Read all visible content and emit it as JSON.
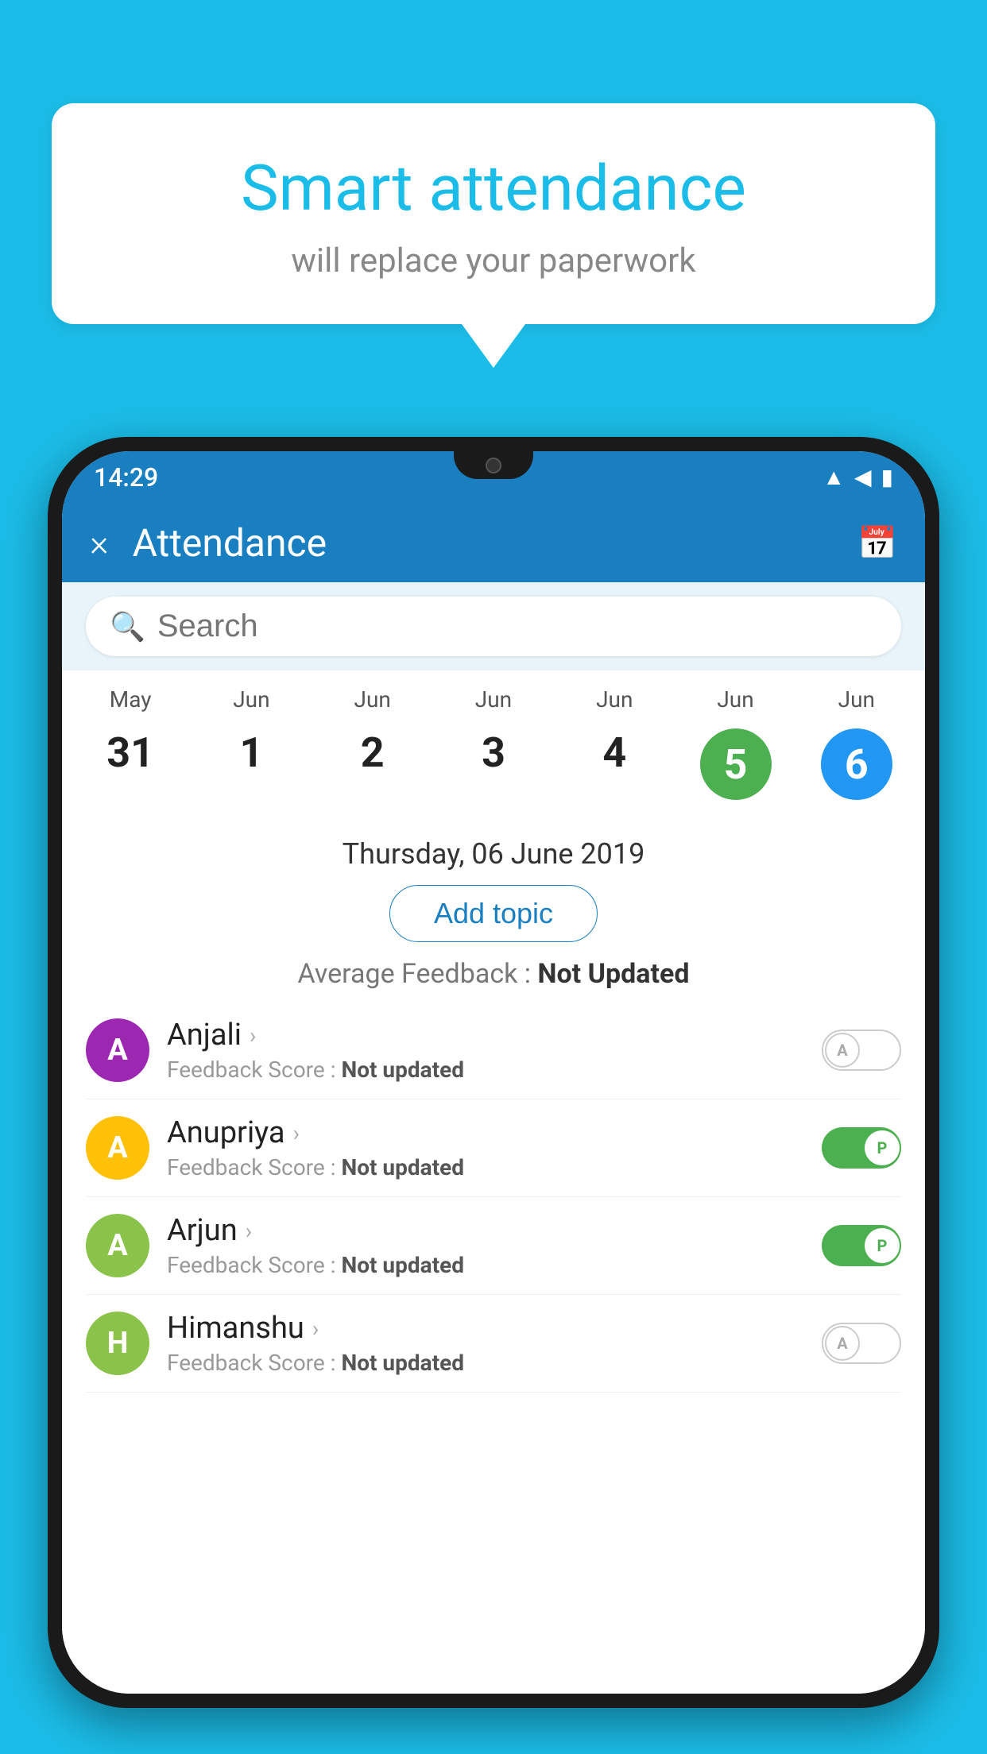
{
  "background_color": "#1BBDE8",
  "speech_bubble": {
    "title": "Smart attendance",
    "subtitle": "will replace your paperwork"
  },
  "status_bar": {
    "time": "14:29",
    "wifi_icon": "wifi",
    "signal_icon": "signal",
    "battery_icon": "battery"
  },
  "app_bar": {
    "close_label": "×",
    "title": "Attendance",
    "calendar_icon": "calendar"
  },
  "search": {
    "placeholder": "Search"
  },
  "calendar": {
    "months": [
      "May",
      "Jun",
      "Jun",
      "Jun",
      "Jun",
      "Jun",
      "Jun"
    ],
    "days": [
      "31",
      "1",
      "2",
      "3",
      "4",
      "5",
      "6"
    ],
    "selected_index": 6,
    "today_index": 5
  },
  "selected_date_label": "Thursday, 06 June 2019",
  "add_topic_label": "Add topic",
  "avg_feedback": {
    "label": "Average Feedback :",
    "value": "Not Updated"
  },
  "students": [
    {
      "name": "Anjali",
      "avatar_letter": "A",
      "avatar_color": "#9C27B0",
      "feedback_label": "Feedback Score :",
      "feedback_value": "Not updated",
      "toggle": "off",
      "toggle_letter": "A"
    },
    {
      "name": "Anupriya",
      "avatar_letter": "A",
      "avatar_color": "#FFC107",
      "feedback_label": "Feedback Score :",
      "feedback_value": "Not updated",
      "toggle": "on",
      "toggle_letter": "P"
    },
    {
      "name": "Arjun",
      "avatar_letter": "A",
      "avatar_color": "#8BC34A",
      "feedback_label": "Feedback Score :",
      "feedback_value": "Not updated",
      "toggle": "on",
      "toggle_letter": "P"
    },
    {
      "name": "Himanshu",
      "avatar_letter": "H",
      "avatar_color": "#8BC34A",
      "feedback_label": "Feedback Score :",
      "feedback_value": "Not updated",
      "toggle": "off",
      "toggle_letter": "A"
    }
  ]
}
